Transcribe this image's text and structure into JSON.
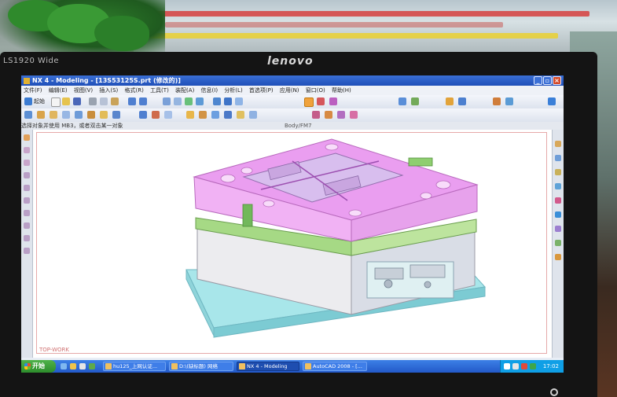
{
  "monitor": {
    "model_label": "LS1920 Wide",
    "brand": "lenovo"
  },
  "window": {
    "title": "NX 4 - Modeling - [13S53125S.prt (修改的)]",
    "controls": [
      "minimize",
      "restore",
      "close"
    ]
  },
  "menu": [
    "文件(F)",
    "编辑(E)",
    "视图(V)",
    "插入(S)",
    "格式(R)",
    "工具(T)",
    "装配(A)",
    "信息(I)",
    "分析(L)",
    "首选项(P)",
    "应用(N)",
    "窗口(O)",
    "帮助(H)"
  ],
  "toolbar": {
    "start_label": "起始"
  },
  "cue_line": {
    "prompt": "选择对象并使用 MB3，或者双击某一对象",
    "status": "Body/FM7"
  },
  "viewport": {
    "label": "TOP-WORK"
  },
  "taskbar": {
    "start_label": "开始",
    "tasks": [
      {
        "label": "hu125_上网认证..."
      },
      {
        "label": "D:\\(缺标题) 网络"
      },
      {
        "label": "NX 4 - Modeling"
      },
      {
        "label": "AutoCAD 2008 - [..."
      }
    ],
    "clock": "17:02"
  },
  "colors": {
    "cad_plate_top": "#e08be6",
    "cad_plate_green": "#9cd27a",
    "cad_base": "#9fe3e8",
    "titlebar": "#2556c4"
  }
}
